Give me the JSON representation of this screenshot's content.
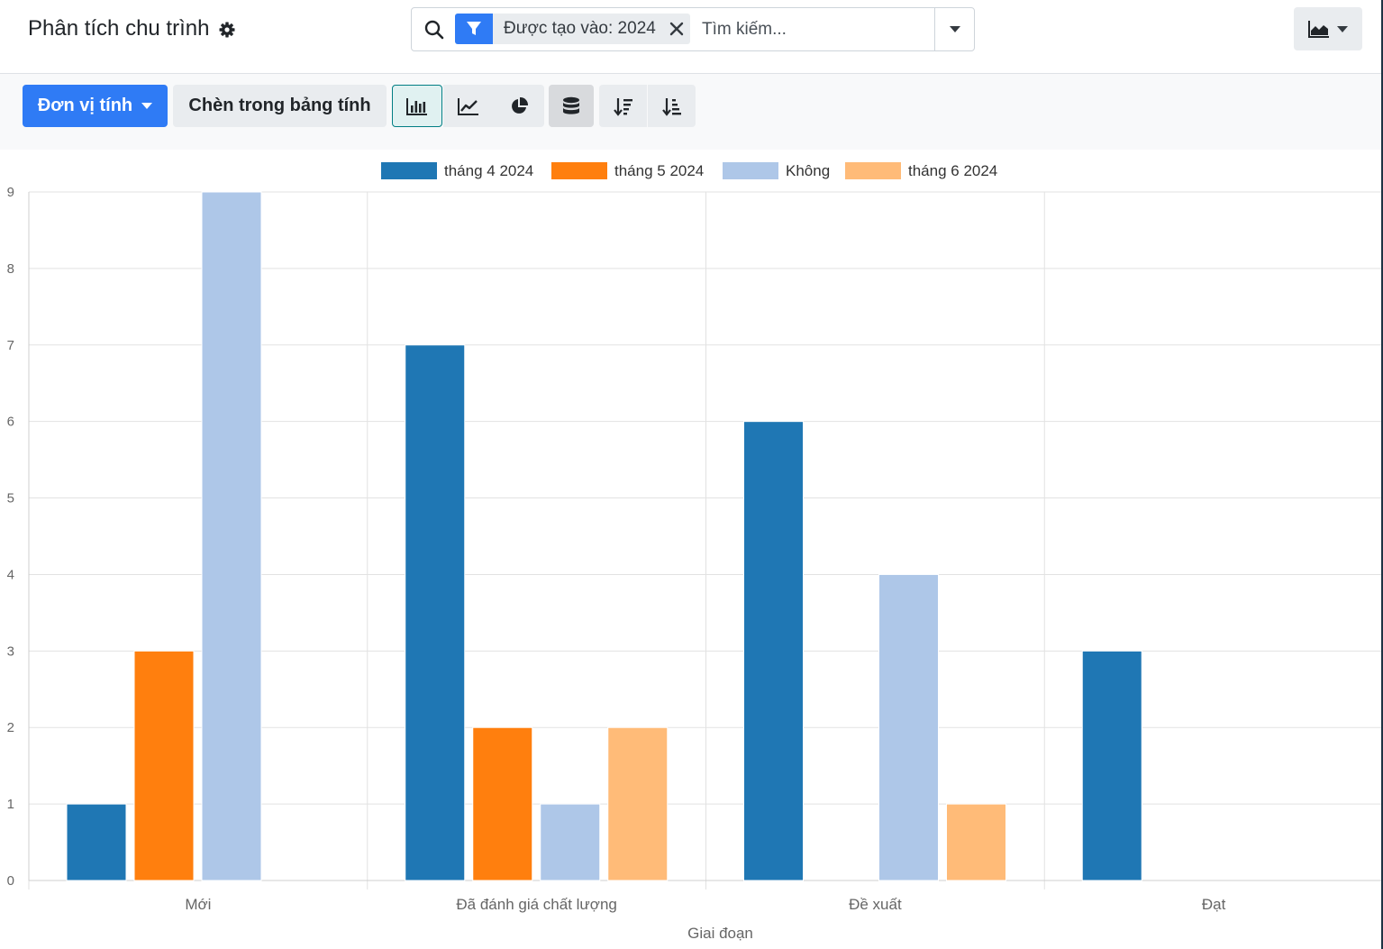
{
  "header": {
    "title": "Phân tích chu trình",
    "search": {
      "facet_label": "Được tạo vào: 2024",
      "placeholder": "Tìm kiếm..."
    }
  },
  "toolbar": {
    "measure_label": "Đơn vị tính",
    "insert_label": "Chèn trong bảng tính"
  },
  "colors": {
    "primary": "#2f7bf5",
    "active_border": "#017e84"
  },
  "chart_data": {
    "type": "bar",
    "categories": [
      "Mới",
      "Đã đánh giá chất lượng",
      "Đề xuất",
      "Đạt"
    ],
    "series": [
      {
        "name": "tháng 4 2024",
        "color": "#1f77b4",
        "values": [
          1,
          7,
          6,
          3
        ]
      },
      {
        "name": "tháng 5 2024",
        "color": "#ff7f0e",
        "values": [
          3,
          2,
          0,
          0
        ]
      },
      {
        "name": "Không",
        "color": "#aec7e8",
        "values": [
          9,
          1,
          4,
          0
        ]
      },
      {
        "name": "tháng 6 2024",
        "color": "#ffbb78",
        "values": [
          0,
          2,
          1,
          0
        ]
      }
    ],
    "xlabel": "Giai đoạn",
    "ylabel": "",
    "ylim": [
      0,
      9
    ],
    "yticks": [
      0,
      1,
      2,
      3,
      4,
      5,
      6,
      7,
      8,
      9
    ],
    "grid": true,
    "legend": "top-center"
  }
}
